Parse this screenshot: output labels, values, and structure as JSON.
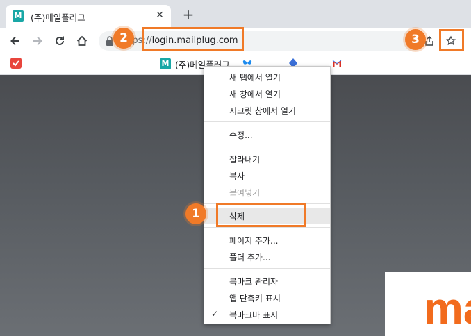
{
  "tab": {
    "favicon": "M",
    "title": "(주)메일플러그",
    "close": "✕"
  },
  "new_tab": "+",
  "toolbar": {
    "url_prefix": "https://",
    "url_host": "login.mailplug.com"
  },
  "bookmarks": {
    "mail_favicon": "M",
    "mail_label": "(주)메일플러그"
  },
  "context_menu": {
    "items": [
      "새 탭에서 열기",
      "새 창에서 열기",
      "시크릿 창에서 열기",
      "수정...",
      "잘라내기",
      "복사",
      "붙여넣기",
      "삭제",
      "페이지 추가...",
      "폴더 추가...",
      "북마크 관리자",
      "앱 단축키 표시",
      "북마크바 표시"
    ],
    "check": "✓"
  },
  "callouts": [
    "1",
    "2",
    "3"
  ],
  "page": {
    "brand_text": "ma"
  },
  "colors": {
    "accent": "#f07a28",
    "favicon": "#19a7a6",
    "brand": "#f26b1d"
  }
}
